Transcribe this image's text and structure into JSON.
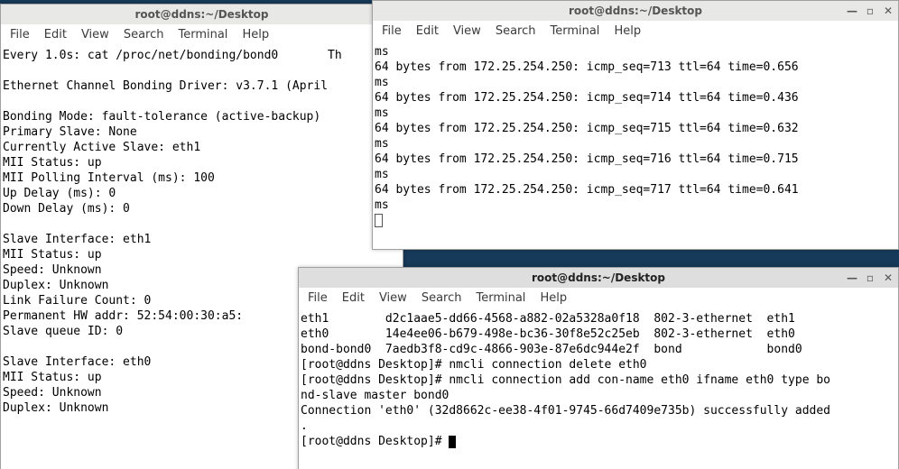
{
  "menus": {
    "file": "File",
    "edit": "Edit",
    "view": "View",
    "search": "Search",
    "terminal": "Terminal",
    "help": "Help"
  },
  "window_left": {
    "title": "root@ddns:~/Desktop",
    "content": "Every 1.0s: cat /proc/net/bonding/bond0       Th\n\nEthernet Channel Bonding Driver: v3.7.1 (April\n\nBonding Mode: fault-tolerance (active-backup)\nPrimary Slave: None\nCurrently Active Slave: eth1\nMII Status: up\nMII Polling Interval (ms): 100\nUp Delay (ms): 0\nDown Delay (ms): 0\n\nSlave Interface: eth1\nMII Status: up\nSpeed: Unknown\nDuplex: Unknown\nLink Failure Count: 0\nPermanent HW addr: 52:54:00:30:a5:\nSlave queue ID: 0\n\nSlave Interface: eth0\nMII Status: up\nSpeed: Unknown\nDuplex: Unknown"
  },
  "window_right_top": {
    "title": "root@ddns:~/Desktop",
    "content": "ms\n64 bytes from 172.25.254.250: icmp_seq=713 ttl=64 time=0.656\nms\n64 bytes from 172.25.254.250: icmp_seq=714 ttl=64 time=0.436\nms\n64 bytes from 172.25.254.250: icmp_seq=715 ttl=64 time=0.632\nms\n64 bytes from 172.25.254.250: icmp_seq=716 ttl=64 time=0.715\nms\n64 bytes from 172.25.254.250: icmp_seq=717 ttl=64 time=0.641\nms"
  },
  "window_right_bottom": {
    "title": "root@ddns:~/Desktop",
    "content_top": "eth1        d2c1aae5-dd66-4568-a882-02a5328a0f18  802-3-ethernet  eth1\neth0        14e4ee06-b679-498e-bc36-30f8e52c25eb  802-3-ethernet  eth0\nbond-bond0  7aedb3f8-cd9c-4866-903e-87e6dc944e2f  bond            bond0\n[root@ddns Desktop]# nmcli connection delete eth0\n[root@ddns Desktop]# nmcli connection add con-name eth0 ifname eth0 type bo\nnd-slave master bond0\nConnection 'eth0' (32d8662c-ee38-4f01-9745-66d7409e735b) successfully added\n.\n[root@ddns Desktop]# "
  },
  "controls": {
    "minimize": "—",
    "maximize": "▫",
    "close": "✕"
  }
}
